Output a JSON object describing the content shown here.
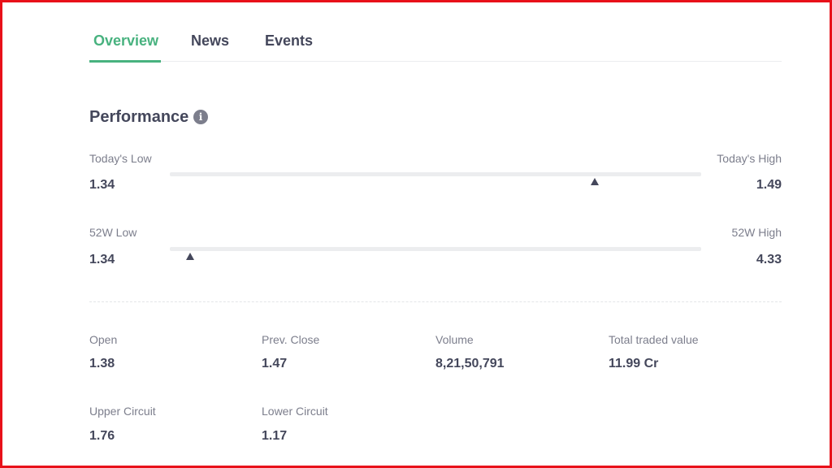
{
  "tabs": {
    "overview": "Overview",
    "news": "News",
    "events": "Events"
  },
  "performance": {
    "title": "Performance",
    "info_icon": "info-icon",
    "today": {
      "low_label": "Today's Low",
      "low_value": "1.34",
      "high_label": "Today's High",
      "high_value": "1.49",
      "marker_fraction": 0.8
    },
    "week52": {
      "low_label": "52W Low",
      "low_value": "1.34",
      "high_label": "52W High",
      "high_value": "4.33",
      "marker_fraction": 0.038
    }
  },
  "stats": {
    "open": {
      "label": "Open",
      "value": "1.38"
    },
    "prev_close": {
      "label": "Prev. Close",
      "value": "1.47"
    },
    "volume": {
      "label": "Volume",
      "value": "8,21,50,791"
    },
    "total_traded": {
      "label": "Total traded value",
      "value": "11.99 Cr"
    },
    "upper_circuit": {
      "label": "Upper Circuit",
      "value": "1.76"
    },
    "lower_circuit": {
      "label": "Lower Circuit",
      "value": "1.17"
    }
  },
  "colors": {
    "accent": "#48b27f",
    "frame": "#e8111a",
    "text": "#44475b",
    "muted": "#7c7e8c"
  }
}
